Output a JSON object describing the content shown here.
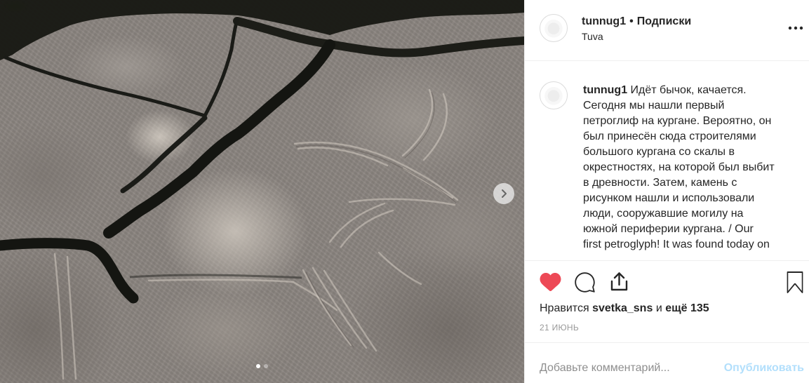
{
  "photo": {
    "next_icon": "chevron-right-icon",
    "carousel": {
      "dot_count": 2,
      "active_index": 0
    }
  },
  "header": {
    "username": "tunnug1",
    "separator": "•",
    "follow_status": "Подписки",
    "location": "Tuva",
    "more_icon": "more-horizontal-icon"
  },
  "caption": {
    "username": "tunnug1",
    "lines": [
      "Идёт бычок, качается.",
      "Сегодня мы нашли первый",
      "петроглиф на кургане. Вероятно, он",
      "был принесён сюда строителями",
      "большого кургана со скалы в",
      "окрестностях, на которой был выбит",
      "в древности. Затем, камень с",
      "рисунком нашли и использовали",
      "люди, сооружавшие могилу на",
      "южной периферии кургана. / Our",
      "first petroglyph! It was found today on"
    ]
  },
  "actions": {
    "like_icon": "heart-filled-icon",
    "comment_icon": "comment-icon",
    "share_icon": "share-icon",
    "save_icon": "bookmark-icon"
  },
  "likes": {
    "prefix": "Нравится",
    "user": "svetka_sns",
    "conjunction": "и",
    "rest": "ещё 135"
  },
  "date": "21 ИЮНЬ",
  "comment_box": {
    "placeholder": "Добавьте комментарий...",
    "post_label": "Опубликовать"
  },
  "colors": {
    "like": "#ed4956",
    "post_button": "#b2dffc",
    "secondary_text": "#999999",
    "divider": "#efefef",
    "text": "#262626"
  }
}
